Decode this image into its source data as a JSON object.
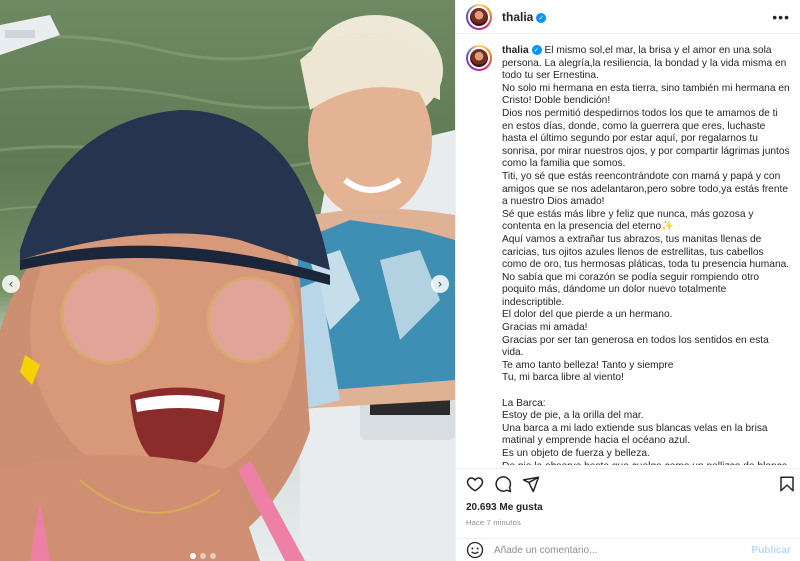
{
  "post": {
    "username": "thalia",
    "verified_badge": "✓",
    "more_label": "•••",
    "caption_paragraphs": [
      "El mismo sol,el mar, la brisa y el amor en una sola persona. La alegría,la resiliencia, la bondad y la vida misma en todo tu ser Ernestina.",
      "No solo mi hermana en esta tierra, sino también mi hermana en Cristo! Doble bendición!",
      "Dios nos permitió despedirnos todos los que te amamos de ti en estos días, donde, como la guerrera que eres, luchaste hasta el último segundo por estar aquí, por regalarnos tu sonrisa, por mirar nuestros ojos, y por compartir lágrimas juntos como la familia que somos.",
      "Titi, yo sé que estás reencontrándote con mamá y papá y con amigos que se nos adelantaron,pero sobre todo,ya estás frente a nuestro Dios amado!",
      "Sé que estás más libre y feliz que nunca, más gozosa y contenta en la presencia del eterno✨",
      "Aquí vamos a extrañar tus abrazos, tus manitas llenas de caricias, tus ojitos azules llenos de estrellitas, tus cabellos como de oro, tus hermosas pláticas, toda tu presencia humana.",
      "No sabía que mi corazón se podía seguir rompiendo otro poquito más, dándome un dolor nuevo totalmente indescriptible.",
      "El dolor del que pierde a un hermano.",
      "Gracias mi amada!",
      "Gracias por ser tan generosa en todos los sentidos en esta vida.",
      "Te amo tanto belleza! Tanto y siempre",
      "Tu, mi barca libre al viento!",
      "",
      "La Barca:",
      "Estoy de pie, a la orilla del mar.",
      "Una barca a mi lado extiende sus blancas velas en la brisa matinal y emprende hacia el océano azul.",
      "Es un objeto de fuerza y belleza.",
      "De pie la observo hasta que cuelga como un pellizco de blanca"
    ],
    "likes": "20.693 Me gusta",
    "time_ago": "Hace 7 minutos",
    "comment_placeholder": "Añade un comentario...",
    "publish_label": "Publicar",
    "photo": {
      "prev_icon": "‹",
      "next_icon": "›"
    }
  },
  "colors": {
    "verified": "#0095f6",
    "publish": "#b3dbff",
    "muted": "#8e8e8e"
  },
  "icons": [
    "heart-icon",
    "comment-icon",
    "share-icon",
    "bookmark-icon",
    "emoji-icon"
  ]
}
